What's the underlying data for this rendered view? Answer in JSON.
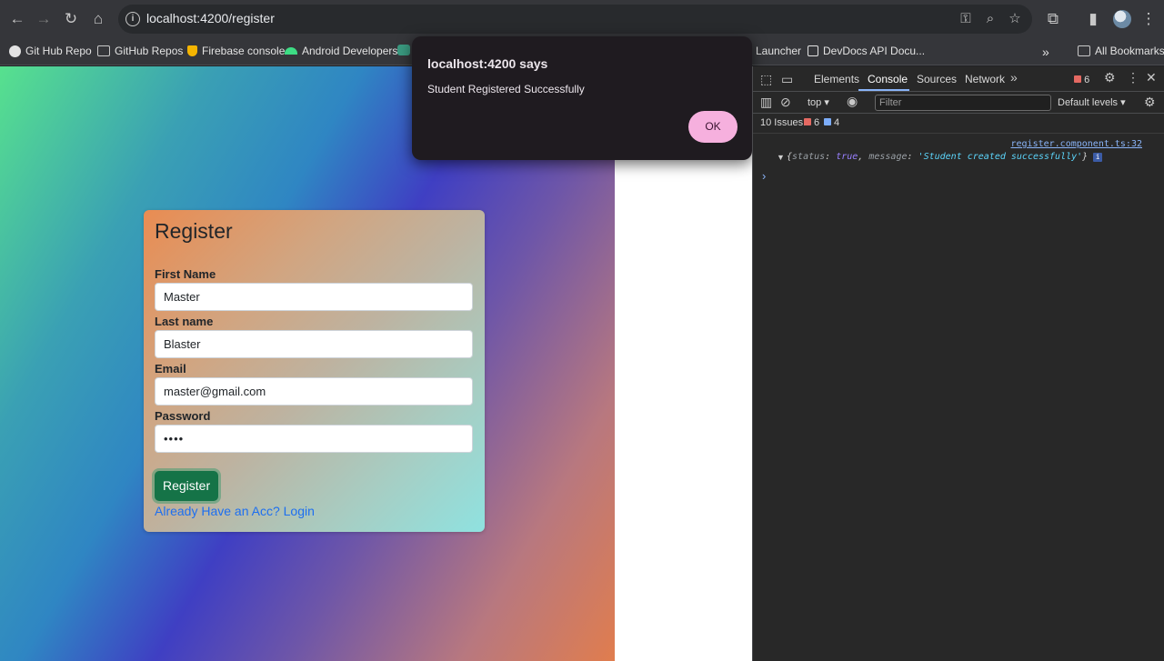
{
  "browser": {
    "url": "localhost:4200/register",
    "bookmarks": [
      {
        "label": "Git Hub Repo",
        "icon": "github-icon"
      },
      {
        "label": "GitHub Repos",
        "icon": "folder-icon"
      },
      {
        "label": "Firebase console",
        "icon": "firebase-icon"
      },
      {
        "label": "Android Developers",
        "icon": "android-icon"
      },
      {
        "label": "Launcher",
        "icon": "launcher-icon"
      },
      {
        "label": "DevDocs API Docu...",
        "icon": "devdocs-icon"
      },
      {
        "label": "All Bookmarks",
        "icon": "folder-icon"
      }
    ]
  },
  "form": {
    "title": "Register",
    "first_name_label": "First Name",
    "first_name_value": "Master",
    "last_name_label": "Last name",
    "last_name_value": "Blaster",
    "email_label": "Email",
    "email_value": "master@gmail.com",
    "password_label": "Password",
    "password_value": "••••",
    "submit_label": "Register",
    "login_link": "Already Have an Acc? Login"
  },
  "dialog": {
    "title": "localhost:4200 says",
    "message": "Student Registered Successfully",
    "ok_label": "OK"
  },
  "devtools": {
    "tabs": [
      "Elements",
      "Console",
      "Sources",
      "Network"
    ],
    "active_tab": "Console",
    "error_badge_count": "6",
    "context": "top",
    "filter_placeholder": "Filter",
    "levels": "Default levels",
    "issues_label": "10 Issues:",
    "issues_errors": "6",
    "issues_info": "4",
    "log_source": "register.component.ts:32",
    "log": {
      "status_key": "status",
      "status_value": "true",
      "message_key": "message",
      "message_value": "'Student created successfully'"
    }
  },
  "colors": {
    "register_button": "#157347",
    "link": "#1d6ff0",
    "dialog_ok": "#f6b0de"
  }
}
